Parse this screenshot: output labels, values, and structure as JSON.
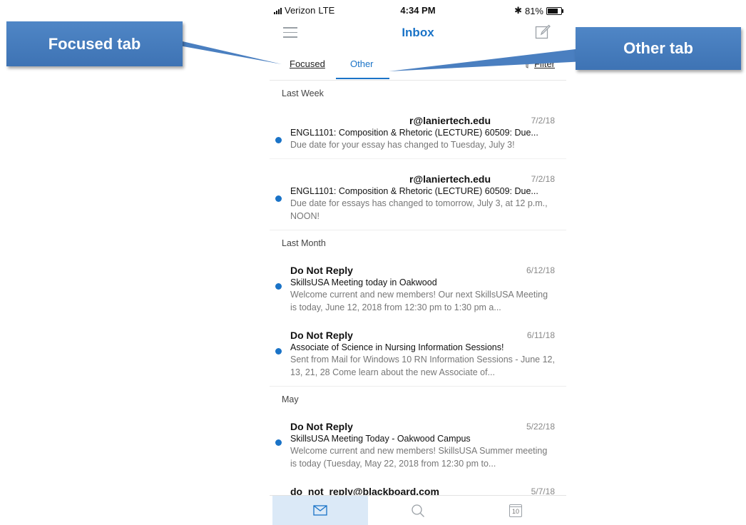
{
  "status": {
    "carrier": "Verizon",
    "network": "LTE",
    "time": "4:34 PM",
    "bluetooth": "✱",
    "battery_text": "81%",
    "battery_level": 0.81
  },
  "nav": {
    "title": "Inbox",
    "menu_icon": "hamburger-menu-icon",
    "compose_icon": "compose-icon"
  },
  "tabs": {
    "focused": "Focused",
    "other": "Other",
    "filter": "Filter",
    "active": "other"
  },
  "sections": [
    {
      "header": "Last Week",
      "mails": [
        {
          "sender": "r@laniertech.edu",
          "date": "7/2/18",
          "subject": "ENGL1101: Composition & Rhetoric (LECTURE) 60509: Due...",
          "preview": "Due date for your essay has changed to Tuesday, July 3!"
        },
        {
          "sender": "r@laniertech.edu",
          "date": "7/2/18",
          "subject": "ENGL1101: Composition & Rhetoric (LECTURE) 60509: Due...",
          "preview": "Due date for essays has changed to tomorrow, July 3, at 12 p.m., NOON!"
        }
      ]
    },
    {
      "header": "Last Month",
      "mails": [
        {
          "sender": "Do Not Reply",
          "date": "6/12/18",
          "subject": "SkillsUSA Meeting today in Oakwood",
          "preview": "Welcome current and new members! Our next SkillsUSA Meeting is today, June 12, 2018 from 12:30 pm to 1:30 pm a..."
        },
        {
          "sender": "Do Not Reply",
          "date": "6/11/18",
          "subject": "Associate of Science in Nursing Information Sessions!",
          "preview": "Sent from Mail for Windows 10 RN Information Sessions - June 12, 13, 21, 28 Come learn about the new Associate of..."
        }
      ]
    },
    {
      "header": "May",
      "mails": [
        {
          "sender": "Do Not Reply",
          "date": "5/22/18",
          "subject": "SkillsUSA Meeting Today - Oakwood Campus",
          "preview": "Welcome current and new members! SkillsUSA Summer meeting is today (Tuesday, May 22, 2018 from 12:30 pm to..."
        },
        {
          "sender": "do_not_reply@blackboard.com",
          "date": "5/7/18",
          "subject": "",
          "preview": ""
        }
      ]
    }
  ],
  "tabbar": {
    "mail_icon": "mail-icon",
    "search_icon": "search-icon",
    "calendar_icon": "calendar-icon",
    "calendar_day": "10"
  },
  "callouts": {
    "focused": "Focused tab",
    "other": "Other tab"
  },
  "colors": {
    "accent": "#1a73c7",
    "callout": "#4a7fc0"
  }
}
